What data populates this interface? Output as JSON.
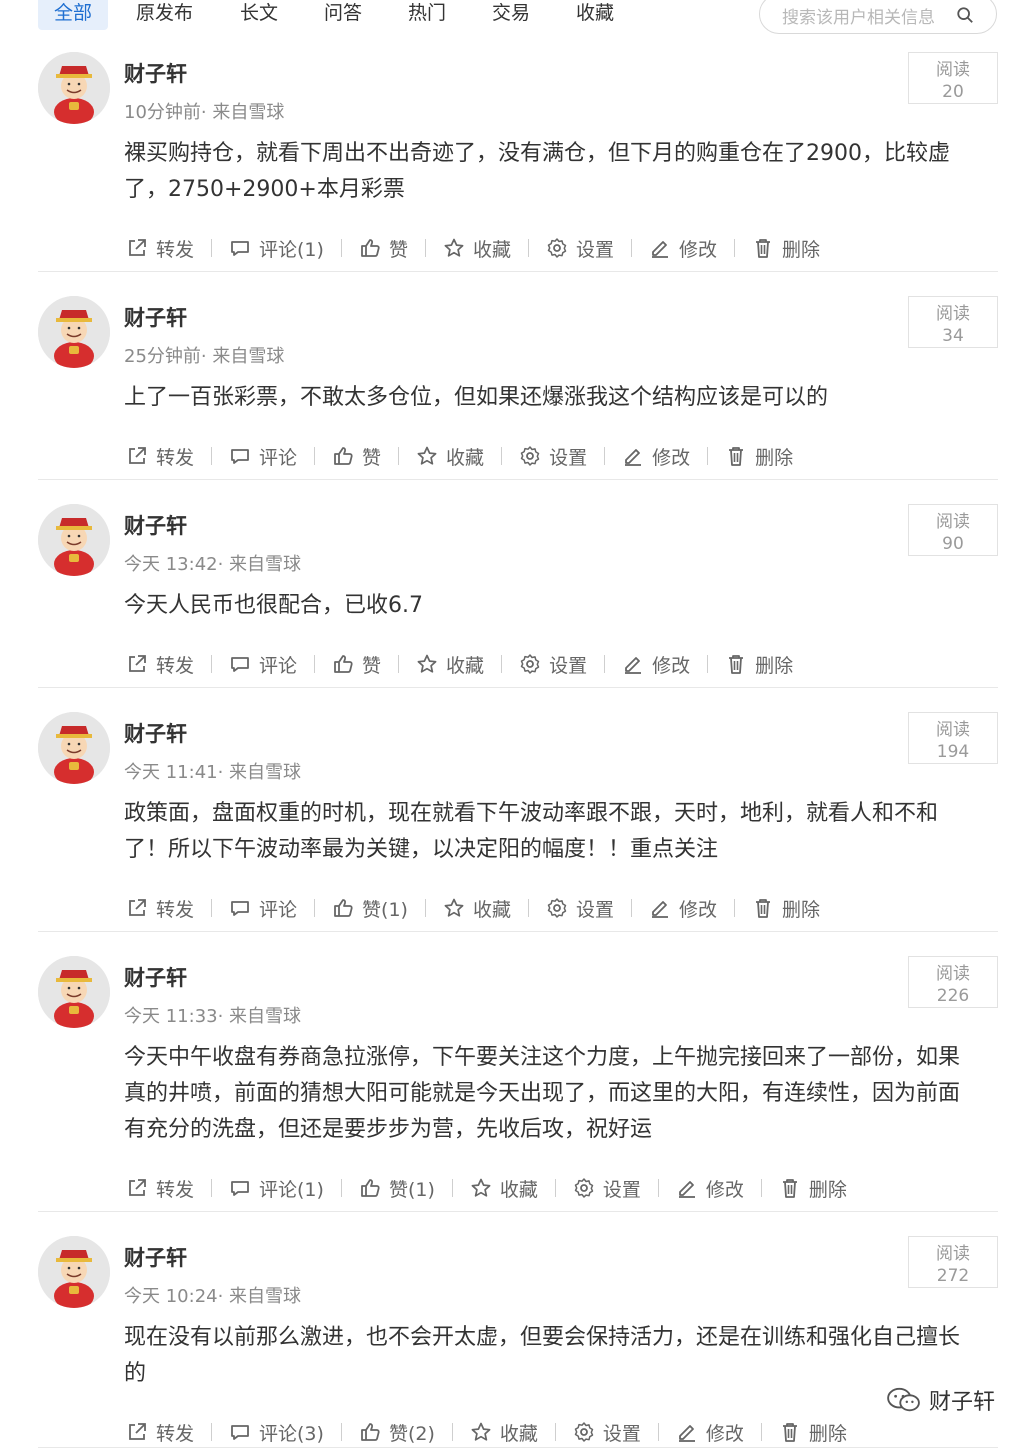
{
  "tabs": [
    "全部",
    "原发布",
    "长文",
    "问答",
    "热门",
    "交易",
    "收藏"
  ],
  "search": {
    "placeholder": "搜索该用户相关信息"
  },
  "read_label": "阅读",
  "actions": {
    "repost": "转发",
    "comment": "评论",
    "like": "赞",
    "favorite": "收藏",
    "settings": "设置",
    "edit": "修改",
    "delete": "删除"
  },
  "posts": [
    {
      "author": "财子轩",
      "time": "10分钟前· 来自雪球",
      "reads": "20",
      "lines": [
        "裸买购持仓，就看下周出不出奇迹了，没有满仓，但下月的购重仓在了2900，比较虚",
        "了，2750+2900+本月彩票"
      ],
      "comment": "评论(1)",
      "like": "赞"
    },
    {
      "author": "财子轩",
      "time": "25分钟前· 来自雪球",
      "reads": "34",
      "lines": [
        "上了一百张彩票，不敢太多仓位，但如果还爆涨我这个结构应该是可以的"
      ],
      "comment": "评论",
      "like": "赞"
    },
    {
      "author": "财子轩",
      "time": "今天 13:42· 来自雪球",
      "reads": "90",
      "lines": [
        "今天人民币也很配合，已收6.7"
      ],
      "comment": "评论",
      "like": "赞"
    },
    {
      "author": "财子轩",
      "time": "今天 11:41· 来自雪球",
      "reads": "194",
      "lines": [
        "政策面，盘面权重的时机，现在就看下午波动率跟不跟，天时，地利，就看人和不和",
        "了！所以下午波动率最为关键，以决定阳的幅度！！重点关注"
      ],
      "comment": "评论",
      "like": "赞(1)"
    },
    {
      "author": "财子轩",
      "time": "今天 11:33· 来自雪球",
      "reads": "226",
      "lines": [
        "今天中午收盘有券商急拉涨停，下午要关注这个力度，上午抛完接回来了一部份，如果",
        "真的井喷，前面的猜想大阳可能就是今天出现了，而这里的大阳，有连续性，因为前面",
        "有充分的洗盘，但还是要步步为营，先收后攻，祝好运"
      ],
      "comment": "评论(1)",
      "like": "赞(1)"
    },
    {
      "author": "财子轩",
      "time": "今天 10:24· 来自雪球",
      "reads": "272",
      "lines": [
        "现在没有以前那么激进，也不会开太虚，但要会保持活力，还是在训练和强化自己擅长",
        "的"
      ],
      "comment": "评论(3)",
      "like": "赞(2)"
    }
  ],
  "watermark": "财子轩"
}
